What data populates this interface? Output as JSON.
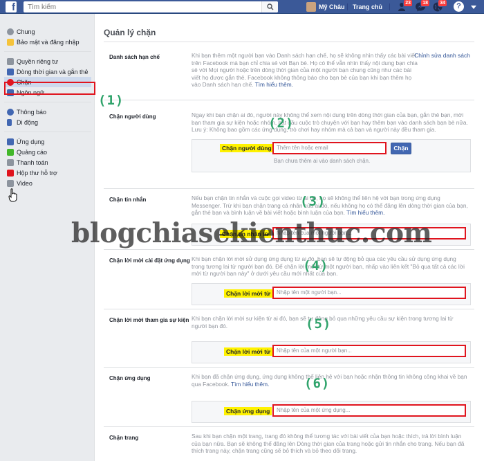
{
  "topbar": {
    "search_placeholder": "Tìm kiếm",
    "profile_name": "Mỹ Châu",
    "home_label": "Trang chủ",
    "friend_badge": "23",
    "message_badge": "18",
    "notif_badge": "34",
    "help_label": "?"
  },
  "sidebar": {
    "groups": [
      [
        {
          "label": "Chung",
          "icon": "gear-icon",
          "color": "#8d949e"
        },
        {
          "label": "Bảo mật và đăng nhập",
          "icon": "lock-icon",
          "color": "#f5c33b"
        }
      ],
      [
        {
          "label": "Quyền riêng tư",
          "icon": "privacy-lock-icon",
          "color": "#8d949e"
        },
        {
          "label": "Dòng thời gian và gắn thẻ",
          "icon": "timeline-icon",
          "color": "#4267b2"
        },
        {
          "label": "Chặn",
          "icon": "block-icon",
          "color": "#e0141e",
          "active": true
        },
        {
          "label": "Ngôn ngữ",
          "icon": "language-icon",
          "color": "#4267b2"
        }
      ],
      [
        {
          "label": "Thông báo",
          "icon": "globe-icon",
          "color": "#4267b2"
        },
        {
          "label": "Di động",
          "icon": "mobile-icon",
          "color": "#4267b2"
        }
      ],
      [
        {
          "label": "Ứng dụng",
          "icon": "apps-icon",
          "color": "#4267b2"
        },
        {
          "label": "Quảng cáo",
          "icon": "ads-icon",
          "color": "#42b72a"
        },
        {
          "label": "Thanh toán",
          "icon": "payment-icon",
          "color": "#8d949e"
        },
        {
          "label": "Hộp thư hỗ trợ",
          "icon": "support-inbox-icon",
          "color": "#e0141e"
        },
        {
          "label": "Video",
          "icon": "video-icon",
          "color": "#8d949e"
        }
      ]
    ]
  },
  "main": {
    "title": "Quản lý chặn",
    "sections": [
      {
        "label": "Danh sách hạn chế",
        "desc": "Khi bạn thêm một người bạn vào Danh sách hạn chế, họ sẽ không nhìn thấy các bài viết trên Facebook mà bạn chỉ chia sẻ với Bạn bè. Họ có thể vẫn nhìn thấy nội dung bạn chia sẻ với Mọi người hoặc trên dòng thời gian của một người bạn chung cũng như các bài viết họ được gắn thẻ. Facebook không thông báo cho bạn bè của bạn khi bạn thêm họ vào Danh sách hạn chế.",
        "link": "Tìm hiểu thêm.",
        "edit": "Chỉnh sửa danh sách"
      },
      {
        "label": "Chặn người dùng",
        "desc": "Ngay khi bạn chặn ai đó, người này không thể xem nội dung trên dòng thời gian của bạn, gắn thẻ bạn, mời bạn tham gia sự kiện hoặc nhóm, bắt đầu cuộc trò chuyện với bạn hay thêm bạn vào danh sách bạn bè nữa. Lưu ý: Không bao gồm các ứng dụng, trò chơi hay nhóm mà cả bạn và người này đều tham gia.",
        "form_label": "Chặn người dùng",
        "placeholder": "Thêm tên hoặc email",
        "button": "Chặn",
        "note": "Bạn chưa thêm ai vào danh sách chặn."
      },
      {
        "label": "Chặn tin nhắn",
        "desc": "Nếu bạn chặn tin nhắn và cuộc gọi video từ ai đó, họ sẽ không thể liên hệ với bạn trong ứng dụng Messenger. Trừ khi bạn chặn trang cá nhân của ai đó, nếu không họ có thể đăng lên dòng thời gian của bạn, gắn thẻ bạn và bình luận về bài viết hoặc bình luận của bạn.",
        "link": "Tìm hiểu thêm.",
        "form_label": "Chặn tin nhắn từ",
        "placeholder": "Nhập tên của một người bạn..."
      },
      {
        "label": "Chặn lời mời cài đặt ứng dụng",
        "desc": "Khi bạn chặn lời mời sử dụng ứng dụng từ ai đó, bạn sẽ tự động bỏ qua các yêu cầu sử dụng ứng dụng trong tương lai từ người bạn đó. Để chặn lời mời từ một người bạn, nhấp vào liên kết \"Bỏ qua tất cả các lời mời từ người bạn này\" ở dưới yêu cầu mới nhất của bạn.",
        "form_label": "Chặn lời mời từ",
        "placeholder": "Nhập tên một người bạn..."
      },
      {
        "label": "Chặn lời mời tham gia sự kiện",
        "desc": "Khi bạn chặn lời mời sự kiện từ ai đó, bạn sẽ tự động bỏ qua những yêu cầu sự kiện trong tương lai từ người bạn đó.",
        "form_label": "Chặn lời mời từ",
        "placeholder": "Nhập tên của một người bạn..."
      },
      {
        "label": "Chặn ứng dụng",
        "desc": "Khi bạn đã chặn ứng dụng, ứng dụng không thể liên hệ với bạn hoặc nhận thông tin không công khai về bạn qua Facebook.",
        "link": "Tìm hiểu thêm.",
        "form_label": "Chặn ứng dụng",
        "placeholder": "Nhập tên của một ứng dụng..."
      },
      {
        "label": "Chặn trang",
        "desc": "Sau khi bạn chặn một trang, trang đó không thể tương tác với bài viết của bạn hoặc thích, trả lời bình luận của bạn nữa. Bạn sẽ không thể đăng lên Dòng thời gian của trang hoặc gửi tin nhắn cho trang. Nếu bạn đã thích trang này, chặn trang cũng sẽ bỏ thích và bỏ theo dõi trang."
      }
    ]
  },
  "annotations": [
    "(1)",
    "(2)",
    "(3)",
    "(4)",
    "(5)",
    "(6)"
  ],
  "watermark": "blogchiasekienthuc.com",
  "colors": {
    "brand": "#3b5998",
    "highlight": "#fff200",
    "annotation": "#2fa36b",
    "marker": "#e0141e"
  }
}
